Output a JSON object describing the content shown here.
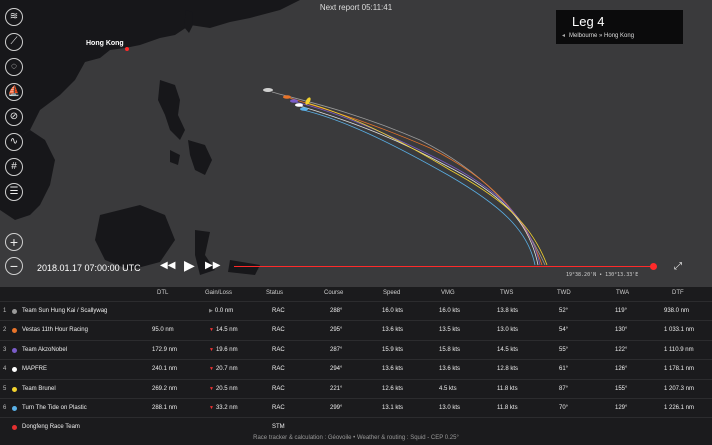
{
  "header": {
    "next_report": "Next report 05:11:41"
  },
  "leg": {
    "title": "Leg 4",
    "route": "Melbourne » Hong Kong"
  },
  "map": {
    "place_label": "Hong Kong"
  },
  "toolbar": {
    "tools": [
      {
        "name": "tool-wind-button",
        "glyph": "≋"
      },
      {
        "name": "tool-route-button",
        "glyph": "⟋"
      },
      {
        "name": "tool-measure-button",
        "glyph": "◌"
      },
      {
        "name": "tool-boat-button",
        "glyph": "⛵"
      },
      {
        "name": "tool-layer-button",
        "glyph": "⊘"
      },
      {
        "name": "tool-track-button",
        "glyph": "∿"
      },
      {
        "name": "tool-grid-button",
        "glyph": "#"
      },
      {
        "name": "tool-list-button",
        "glyph": "☰"
      }
    ],
    "zoom_in": "+",
    "zoom_out": "−"
  },
  "timeline": {
    "datetime": "2018.01.17 07:00:00 UTC",
    "rewind": "◀◀",
    "play": "▶",
    "forward": "▶▶",
    "coords": "19°38.20'N • 130°13.33'E",
    "fullscreen": "⤢",
    "progress": 1.0
  },
  "table": {
    "headers": [
      "DTL",
      "Gain/Loss",
      "Status",
      "Course",
      "Speed",
      "VMG",
      "TWS",
      "TWD",
      "TWA",
      "DTF"
    ],
    "rows": [
      {
        "rank": "1",
        "team": "Team Sun Hung Kai / Scallywag",
        "color": "#9a9a9a",
        "dtl": "",
        "gain": "0.0 nm",
        "gain_dir": "flat",
        "status": "RAC",
        "course": "288°",
        "speed": "16.0 kts",
        "vmg": "16.0 kts",
        "tws": "13.8 kts",
        "twd": "52°",
        "twa": "119°",
        "dtf": "938.0 nm"
      },
      {
        "rank": "2",
        "team": "Vestas 11th Hour Racing",
        "color": "#e8742a",
        "dtl": "95.0 nm",
        "gain": "14.5 nm",
        "gain_dir": "down",
        "status": "RAC",
        "course": "295°",
        "speed": "13.6 kts",
        "vmg": "13.5 kts",
        "tws": "13.0 kts",
        "twd": "54°",
        "twa": "130°",
        "dtf": "1 033.1 nm"
      },
      {
        "rank": "3",
        "team": "Team AkzoNobel",
        "color": "#7a5cc8",
        "dtl": "172.9 nm",
        "gain": "19.6 nm",
        "gain_dir": "down",
        "status": "RAC",
        "course": "287°",
        "speed": "15.9 kts",
        "vmg": "15.8 kts",
        "tws": "14.5 kts",
        "twd": "55°",
        "twa": "122°",
        "dtf": "1 110.9 nm"
      },
      {
        "rank": "4",
        "team": "MAPFRE",
        "color": "#ffffff",
        "dtl": "240.1 nm",
        "gain": "20.7 nm",
        "gain_dir": "down",
        "status": "RAC",
        "course": "294°",
        "speed": "13.6 kts",
        "vmg": "13.6 kts",
        "tws": "12.8 kts",
        "twd": "61°",
        "twa": "126°",
        "dtf": "1 178.1 nm"
      },
      {
        "rank": "5",
        "team": "Team Brunel",
        "color": "#f2d22e",
        "dtl": "269.2 nm",
        "gain": "20.5 nm",
        "gain_dir": "down",
        "status": "RAC",
        "course": "221°",
        "speed": "12.6 kts",
        "vmg": "4.5 kts",
        "tws": "11.8 kts",
        "twd": "87°",
        "twa": "155°",
        "dtf": "1 207.3 nm"
      },
      {
        "rank": "6",
        "team": "Turn The Tide on Plastic",
        "color": "#5ab0e6",
        "dtl": "288.1 nm",
        "gain": "33.2 nm",
        "gain_dir": "down",
        "status": "RAC",
        "course": "299°",
        "speed": "13.1 kts",
        "vmg": "13.0 kts",
        "tws": "11.8 kts",
        "twd": "70°",
        "twa": "129°",
        "dtf": "1 226.1 nm"
      },
      {
        "rank": "",
        "team": "Dongfeng Race Team",
        "color": "#e53030",
        "dtl": "",
        "gain": "",
        "gain_dir": "none",
        "status": "STM",
        "course": "",
        "speed": "",
        "vmg": "",
        "tws": "",
        "twd": "",
        "twa": "",
        "dtf": ""
      }
    ]
  },
  "footer": {
    "text": "Race tracker & calculation : Géovoile • Weather & routing : Squid - CEP 0.25°"
  },
  "colors": {
    "accent": "#ff2a2a",
    "map_sea": "#3a3a3c",
    "map_land": "#17171a"
  }
}
